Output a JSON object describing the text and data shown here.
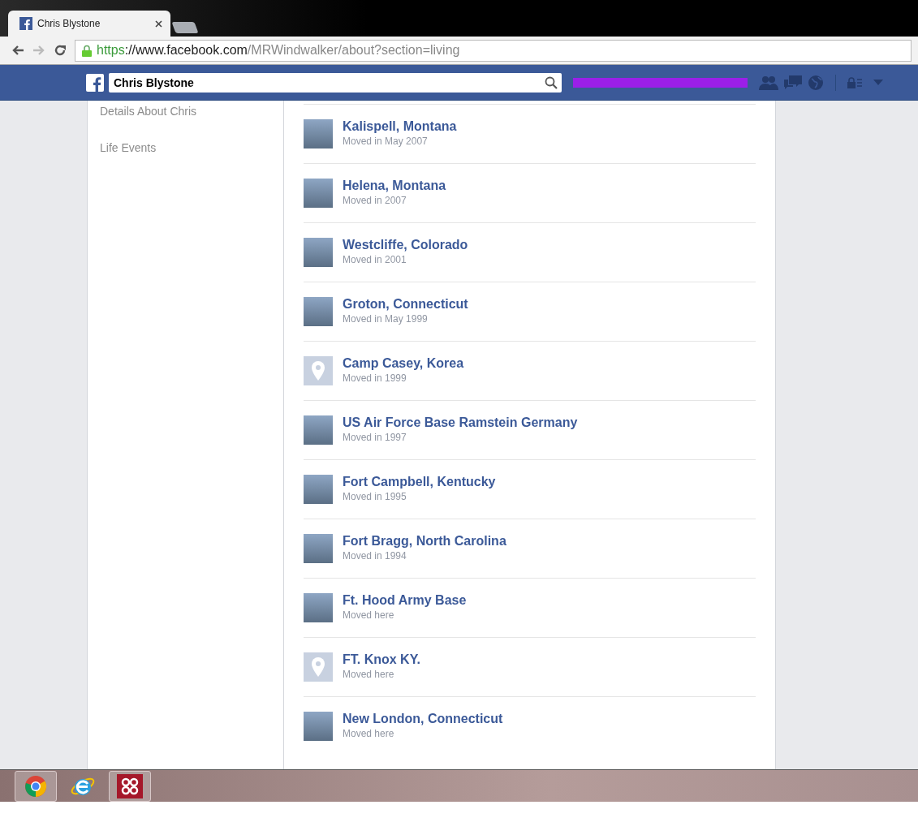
{
  "browser": {
    "tab": {
      "title": "Chris Blystone",
      "selected": true
    },
    "address": {
      "scheme": "https",
      "host": "://www.facebook.com",
      "path": "/MRWindwalker/about?section=living"
    }
  },
  "header": {
    "search_value": "Chris Blystone"
  },
  "sidebar": {
    "items": [
      {
        "label": "Details About Chris"
      },
      {
        "label": "Life Events"
      }
    ]
  },
  "places": [
    {
      "name": "Kalispell, Montana",
      "moved": "Moved in May 2007",
      "kind": "photo"
    },
    {
      "name": "Helena, Montana",
      "moved": "Moved in 2007",
      "kind": "photo"
    },
    {
      "name": "Westcliffe, Colorado",
      "moved": "Moved in 2001",
      "kind": "photo"
    },
    {
      "name": "Groton, Connecticut",
      "moved": "Moved in May 1999",
      "kind": "photo"
    },
    {
      "name": "Camp Casey, Korea",
      "moved": "Moved in 1999",
      "kind": "pin"
    },
    {
      "name": "US Air Force Base Ramstein Germany",
      "moved": "Moved in 1997",
      "kind": "photo"
    },
    {
      "name": "Fort Campbell, Kentucky",
      "moved": "Moved in 1995",
      "kind": "photo"
    },
    {
      "name": "Fort Bragg, North Carolina",
      "moved": "Moved in 1994",
      "kind": "photo"
    },
    {
      "name": "Ft. Hood Army Base",
      "moved": "Moved here",
      "kind": "photo"
    },
    {
      "name": "FT. Knox KY.",
      "moved": "Moved here",
      "kind": "pin"
    },
    {
      "name": "New London, Connecticut",
      "moved": "Moved here",
      "kind": "photo"
    }
  ]
}
